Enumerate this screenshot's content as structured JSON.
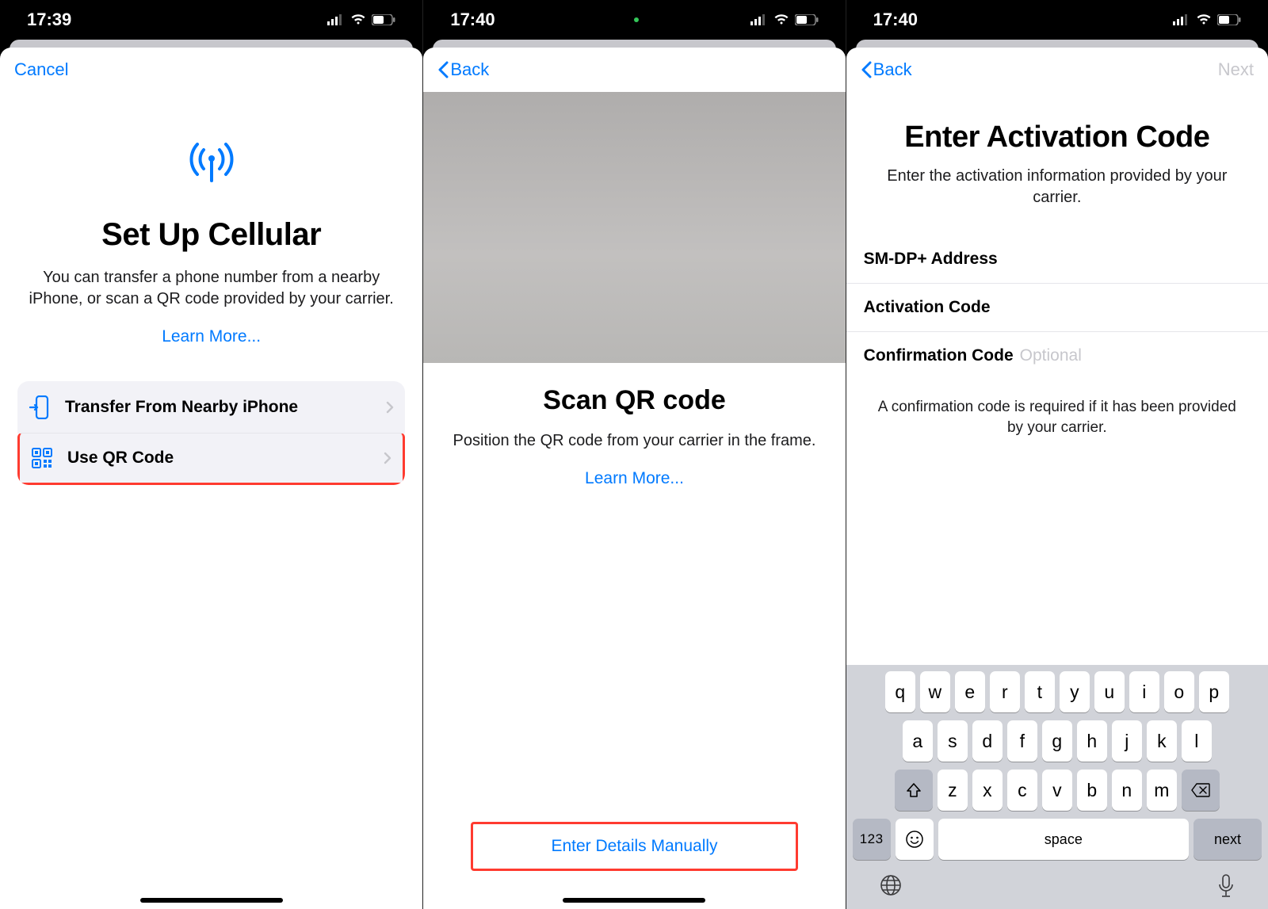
{
  "statusbar": {
    "time1": "17:39",
    "time2": "17:40",
    "time3": "17:40"
  },
  "screen1": {
    "cancel": "Cancel",
    "title": "Set Up Cellular",
    "subtitle": "You can transfer a phone number from a nearby iPhone, or scan a QR code provided by your carrier.",
    "learn": "Learn More...",
    "option_transfer": "Transfer From Nearby iPhone",
    "option_qr": "Use QR Code"
  },
  "screen2": {
    "back": "Back",
    "title": "Scan QR code",
    "subtitle": "Position the QR code from your carrier in the frame.",
    "learn": "Learn More...",
    "manual": "Enter Details Manually"
  },
  "screen3": {
    "back": "Back",
    "next": "Next",
    "title": "Enter Activation Code",
    "subtitle": "Enter the activation information provided by your carrier.",
    "field_smdp": "SM-DP+ Address",
    "field_act": "Activation Code",
    "field_conf": "Confirmation Code",
    "field_conf_ph": "Optional",
    "note": "A confirmation code is required if it has been provided by your carrier."
  },
  "keyboard": {
    "row1": [
      "q",
      "w",
      "e",
      "r",
      "t",
      "y",
      "u",
      "i",
      "o",
      "p"
    ],
    "row2": [
      "a",
      "s",
      "d",
      "f",
      "g",
      "h",
      "j",
      "k",
      "l"
    ],
    "row3": [
      "z",
      "x",
      "c",
      "v",
      "b",
      "n",
      "m"
    ],
    "k123": "123",
    "space": "space",
    "next": "next"
  }
}
